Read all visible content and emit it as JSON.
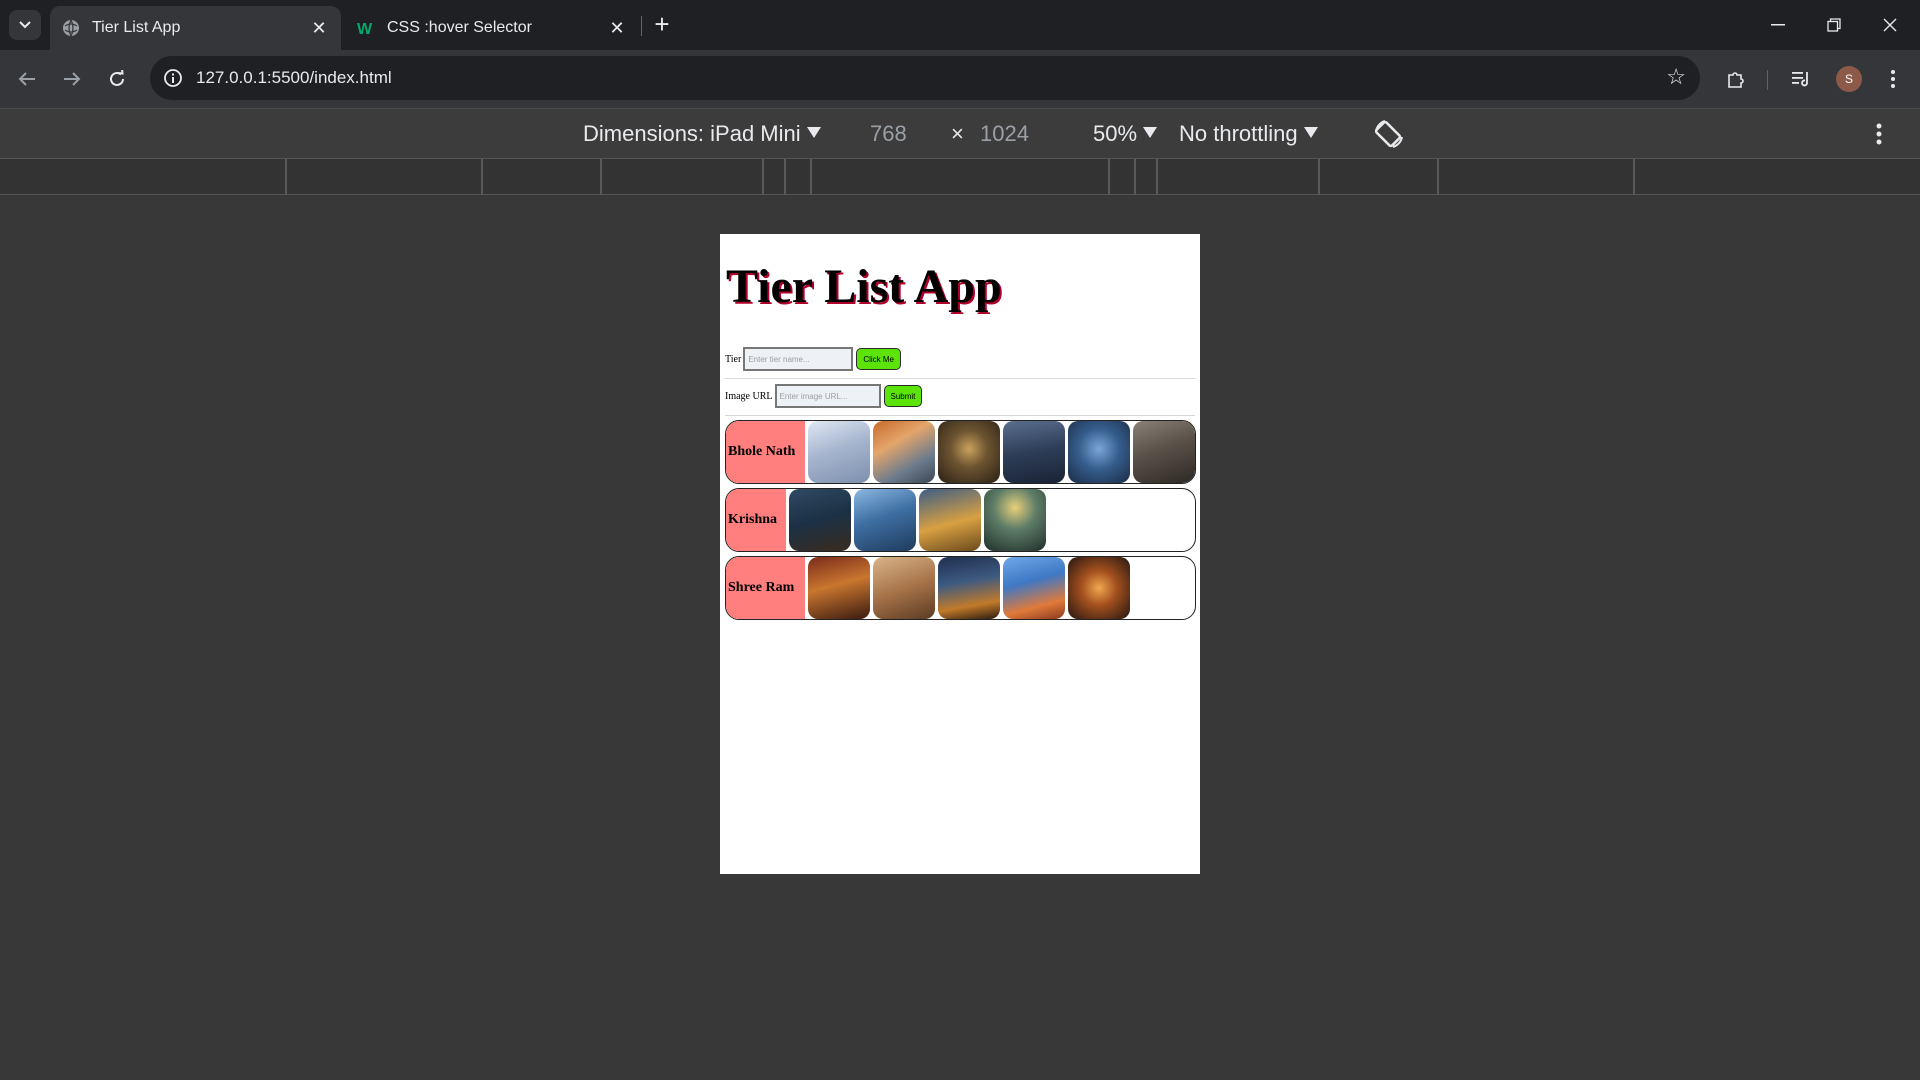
{
  "browser": {
    "tabs": [
      {
        "title": "Tier List App",
        "icon": "globe-icon",
        "active": true
      },
      {
        "title": "CSS :hover Selector",
        "icon": "w3schools-icon",
        "active": false
      }
    ],
    "url": "127.0.0.1:5500/index.html",
    "profile_initial": "S"
  },
  "devtools": {
    "dimensions_label": "Dimensions: iPad Mini",
    "width": "768",
    "times": "×",
    "height": "1024",
    "zoom": "50%",
    "throttling": "No throttling"
  },
  "app": {
    "title": "Tier List App",
    "tier_label": "Tier",
    "tier_placeholder": "Enter tier name...",
    "tier_button": "Click Me",
    "image_label": "Image URL",
    "image_placeholder": "Enter image URL...",
    "image_button": "Submit",
    "tiers": [
      {
        "name": "Bhole Nath",
        "image_count": 6
      },
      {
        "name": "Krishna",
        "image_count": 4
      },
      {
        "name": "Shree Ram",
        "image_count": 5
      }
    ]
  },
  "colors": {
    "tier_label_bg": "#ff7f7f",
    "button_bg": "#5be30a",
    "title_shadow": "#b0002a"
  }
}
